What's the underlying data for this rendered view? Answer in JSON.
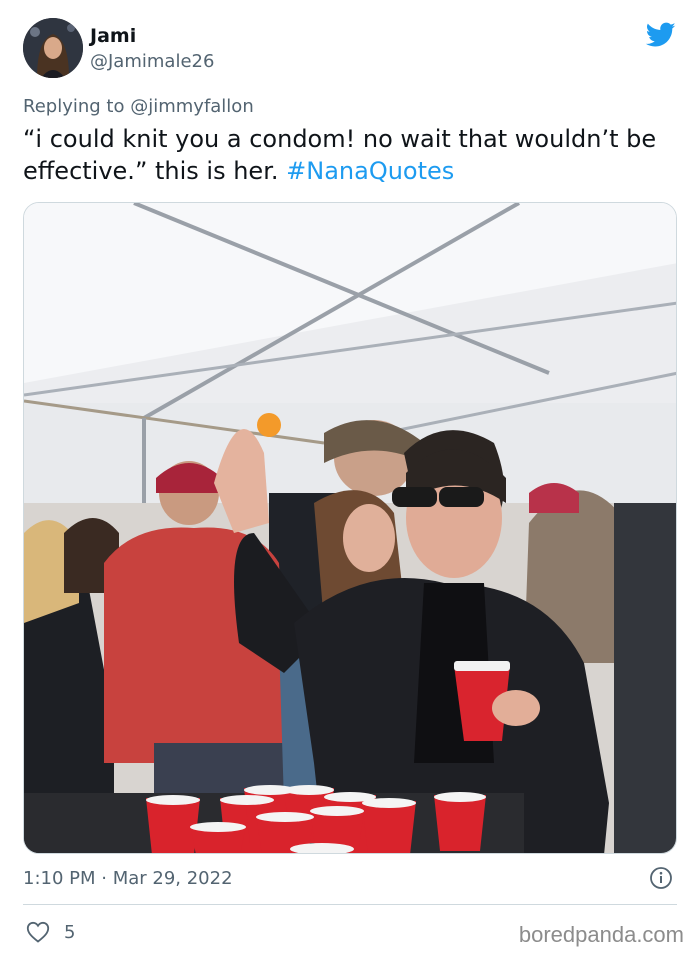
{
  "tweet": {
    "display_name": "Jami",
    "handle": "@Jamimale26",
    "replying_prefix": "Replying to",
    "replying_to": "@jimmyfallon",
    "text": "“i could knit you a condom! no wait that wouldn’t be effective.” this is her. ",
    "hashtag": "#NanaQuotes",
    "timestamp": "1:10 PM · Mar 29, 2022",
    "like_count": "5"
  },
  "icons": {
    "platform": "twitter-bird-icon",
    "info": "info-icon",
    "like": "heart-icon"
  },
  "colors": {
    "accent": "#1d9bf0",
    "secondary_text": "#536471",
    "primary_text": "#0f1419",
    "border": "#cfd9de"
  },
  "watermark": "boredpanda.com"
}
